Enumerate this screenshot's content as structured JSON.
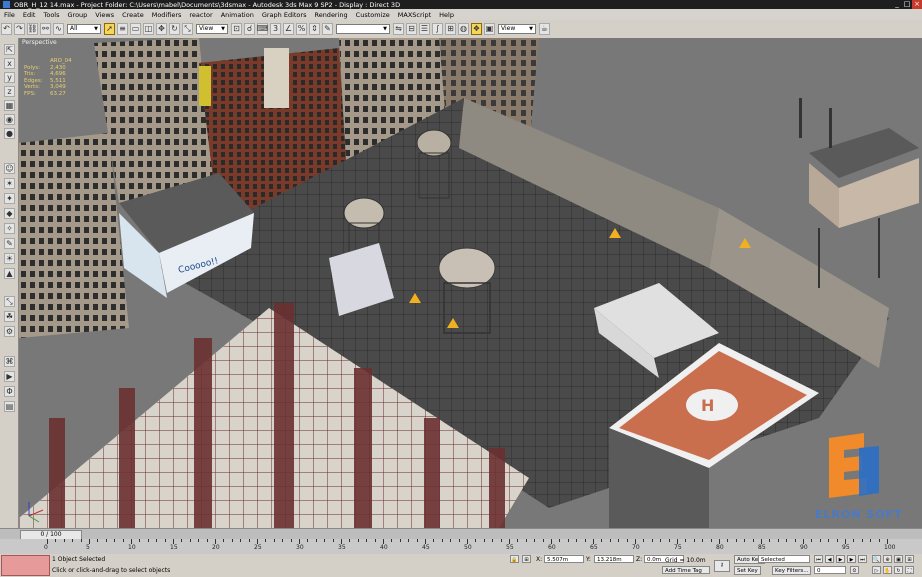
{
  "window": {
    "title": "OBR_H_12 14.max    - Project Folder: C:\\Users\\mabel\\Documents\\3dsmax    - Autodesk 3ds Max 9 SP2    - Display : Direct 3D",
    "controls": [
      "_",
      "□",
      "×"
    ]
  },
  "menu": [
    "File",
    "Edit",
    "Tools",
    "Group",
    "Views",
    "Create",
    "Modifiers",
    "reactor",
    "Animation",
    "Graph Editors",
    "Rendering",
    "Customize",
    "MAXScript",
    "Help"
  ],
  "toolbar": {
    "selection_filter": "All",
    "ref_coord": "View",
    "named_selection": "",
    "view_dropdown": "View"
  },
  "viewport": {
    "label": "Perspective",
    "stats": [
      {
        "k": "",
        "v": "ARO_04"
      },
      {
        "k": "Polys:",
        "v": "2,430"
      },
      {
        "k": "Tris:",
        "v": "4,696"
      },
      {
        "k": "Edges:",
        "v": "5,511"
      },
      {
        "k": "Verts:",
        "v": "3,049"
      },
      {
        "k": "FPS:",
        "v": "63.27"
      }
    ]
  },
  "scene": {
    "billboard_text": "Cooooo!!",
    "watermark": "ELRON SOFT",
    "colors": {
      "sky": "#7a7a7a",
      "helipad": "#c96f4e",
      "wireframe": "#7a3c3c",
      "logo_orange": "#f08a2a",
      "logo_blue": "#2a6fc7"
    }
  },
  "timeline": {
    "slider": "0 / 100",
    "ticks": [
      "0",
      "5",
      "10",
      "15",
      "20",
      "25",
      "30",
      "35",
      "40",
      "45",
      "50",
      "55",
      "60",
      "65",
      "70",
      "75",
      "80",
      "85",
      "90",
      "95",
      "100"
    ]
  },
  "status": {
    "selection": "1 Object Selected",
    "prompt": "Click or click-and-drag to select objects",
    "x_label": "X:",
    "x_value": "5.507m",
    "y_label": "Y:",
    "y_value": "13.218m",
    "z_label": "Z:",
    "z_value": "0.0m",
    "grid": "Grid = 10.0m",
    "add_time_tag": "Add Time Tag",
    "auto_key": "Auto Key",
    "auto_key_mode": "Selected",
    "set_key": "Set Key",
    "key_filters": "Key Filters...",
    "frame": "0"
  }
}
